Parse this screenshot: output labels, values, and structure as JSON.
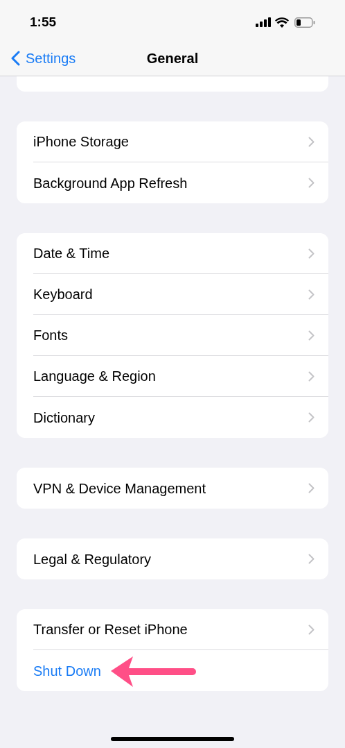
{
  "status_bar": {
    "time": "1:55"
  },
  "nav": {
    "back": "Settings",
    "title": "General"
  },
  "groups": [
    {
      "rows": [
        {
          "kind": "link",
          "label": "iPhone Storage"
        },
        {
          "kind": "link",
          "label": "Background App Refresh"
        }
      ]
    },
    {
      "rows": [
        {
          "kind": "link",
          "label": "Date & Time"
        },
        {
          "kind": "link",
          "label": "Keyboard"
        },
        {
          "kind": "link",
          "label": "Fonts"
        },
        {
          "kind": "link",
          "label": "Language & Region"
        },
        {
          "kind": "link",
          "label": "Dictionary"
        }
      ]
    },
    {
      "rows": [
        {
          "kind": "link",
          "label": "VPN & Device Management"
        }
      ]
    },
    {
      "rows": [
        {
          "kind": "link",
          "label": "Legal & Regulatory"
        }
      ]
    },
    {
      "rows": [
        {
          "kind": "link",
          "label": "Transfer or Reset iPhone"
        },
        {
          "kind": "action",
          "label": "Shut Down"
        }
      ]
    }
  ]
}
